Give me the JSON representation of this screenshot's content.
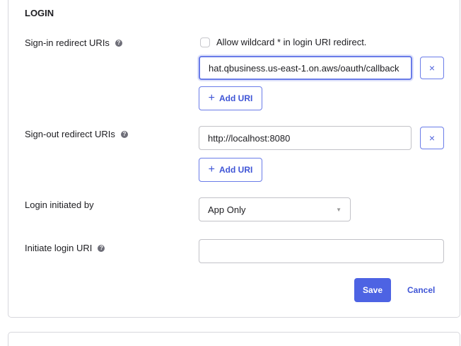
{
  "section_title": "LOGIN",
  "sign_in": {
    "label": "Sign-in redirect URIs",
    "help": "?",
    "wildcard_label": "Allow wildcard * in login URI redirect.",
    "wildcard_checked": false,
    "uri_value": "hat.qbusiness.us-east-1.on.aws/oauth/callback",
    "remove": "×",
    "add_label": "Add URI",
    "add_icon": "+"
  },
  "sign_out": {
    "label": "Sign-out redirect URIs",
    "help": "?",
    "uri_value": "http://localhost:8080",
    "remove": "×",
    "add_label": "Add URI",
    "add_icon": "+"
  },
  "login_initiated": {
    "label": "Login initiated by",
    "value": "App Only",
    "caret": "▼"
  },
  "initiate_uri": {
    "label": "Initiate login URI",
    "help": "?",
    "value": ""
  },
  "actions": {
    "save": "Save",
    "cancel": "Cancel"
  }
}
